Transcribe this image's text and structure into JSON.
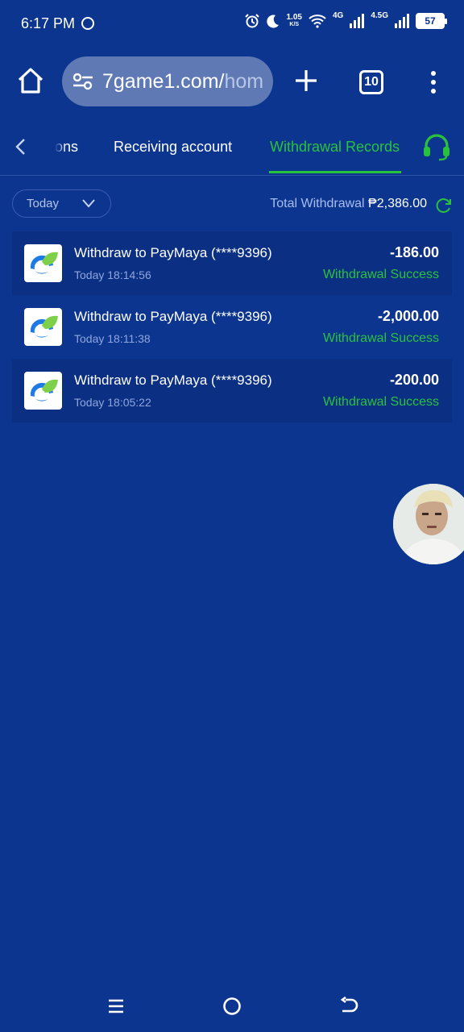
{
  "status_bar": {
    "time": "6:17 PM",
    "speed_value": "1.05",
    "speed_unit": "K/S",
    "network_1": "4G",
    "network_2": "4.5G",
    "battery": "57"
  },
  "browser": {
    "url_main": "7game1.com/",
    "url_rest": "hom",
    "tab_count": "10"
  },
  "tabs": {
    "partial_label": "ons",
    "receiving_label": "Receiving account",
    "active_label": "Withdrawal Records"
  },
  "filter": {
    "date_value": "Today",
    "total_label": "Total Withdrawal ",
    "total_amount": "₱2,386.00"
  },
  "records": [
    {
      "title": "Withdraw to PayMaya (****9396)",
      "time": "Today 18:14:56",
      "amount": "-186.00",
      "status": "Withdrawal Success"
    },
    {
      "title": "Withdraw to PayMaya (****9396)",
      "time": "Today 18:11:38",
      "amount": "-2,000.00",
      "status": "Withdrawal Success"
    },
    {
      "title": "Withdraw to PayMaya (****9396)",
      "time": "Today 18:05:22",
      "amount": "-200.00",
      "status": "Withdrawal Success"
    }
  ],
  "colors": {
    "background": "#0c3590",
    "accent_green": "#28c23d",
    "url_box": "#5f79b5"
  },
  "icons": [
    "home-icon",
    "tune-icon",
    "plus-icon",
    "tab-switcher-icon",
    "more-vert-icon",
    "chevron-left-icon",
    "headset-icon",
    "chevron-down-icon",
    "refresh-icon",
    "paymaya-logo-icon",
    "recents-icon",
    "home-circle-icon",
    "back-icon"
  ]
}
